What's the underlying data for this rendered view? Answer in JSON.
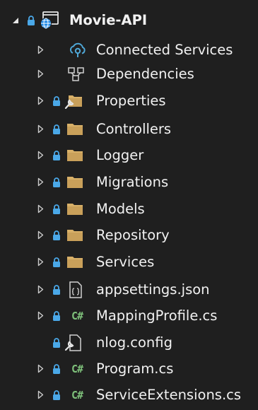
{
  "project": {
    "label": "Movie-API",
    "expand_state": "expanded",
    "icon": "web-project-icon"
  },
  "items": [
    {
      "label": "Connected Services",
      "icon": "connected-services-icon",
      "locked": false,
      "expandable": true
    },
    {
      "label": "Dependencies",
      "icon": "dependencies-icon",
      "locked": false,
      "expandable": true
    },
    {
      "label": "Properties",
      "icon": "properties-folder-icon",
      "locked": true,
      "expandable": true
    },
    {
      "label": "Controllers",
      "icon": "folder-icon",
      "locked": true,
      "expandable": true
    },
    {
      "label": "Logger",
      "icon": "folder-icon",
      "locked": true,
      "expandable": true
    },
    {
      "label": "Migrations",
      "icon": "folder-icon",
      "locked": true,
      "expandable": true
    },
    {
      "label": "Models",
      "icon": "folder-icon",
      "locked": true,
      "expandable": true
    },
    {
      "label": "Repository",
      "icon": "folder-icon",
      "locked": true,
      "expandable": true
    },
    {
      "label": "Services",
      "icon": "folder-icon",
      "locked": true,
      "expandable": true
    },
    {
      "label": "appsettings.json",
      "icon": "json-file-icon",
      "locked": true,
      "expandable": true
    },
    {
      "label": "MappingProfile.cs",
      "icon": "csharp-file-icon",
      "locked": true,
      "expandable": true
    },
    {
      "label": "nlog.config",
      "icon": "config-file-icon",
      "locked": true,
      "expandable": false
    },
    {
      "label": "Program.cs",
      "icon": "csharp-file-icon",
      "locked": true,
      "expandable": true
    },
    {
      "label": "ServiceExtensions.cs",
      "icon": "csharp-file-icon",
      "locked": true,
      "expandable": true
    }
  ],
  "colors": {
    "background": "#1f1f1f",
    "text": "#f1f1f1",
    "lock": "#4aa8e8",
    "folder": "#d8b068",
    "csharp": "#7ec07a",
    "arrow": "#cccccc"
  },
  "glyphs": {
    "csharp": "C#"
  }
}
